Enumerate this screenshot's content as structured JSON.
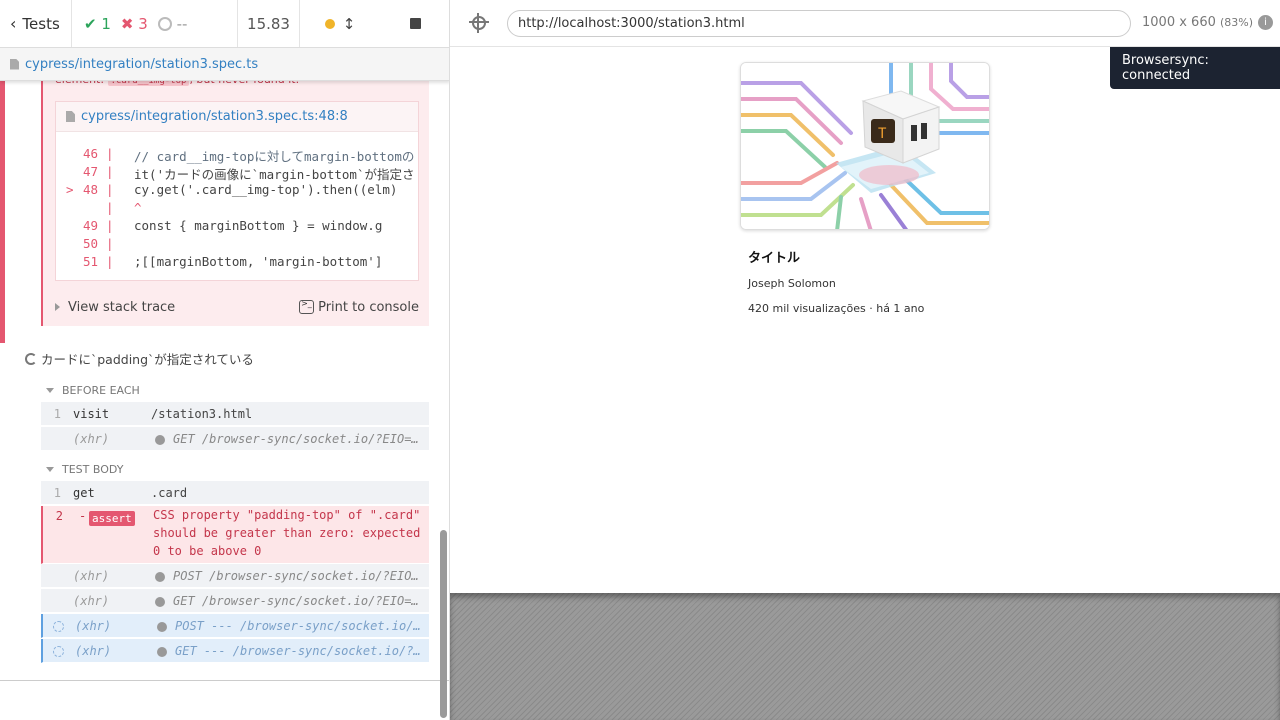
{
  "header": {
    "tests_label": "Tests",
    "passed": "1",
    "failed": "3",
    "pending": "--",
    "duration": "15.83"
  },
  "spec": {
    "file": "cypress/integration/station3.spec.ts"
  },
  "error": {
    "message_prefix": "element:",
    "message_code": ".card__img-top",
    "message_suffix": ", but never found it.",
    "frame_file": "cypress/integration/station3.spec.ts:48:8",
    "lines": [
      {
        "num": "46",
        "marker": "",
        "code": "// card__img-topに対してmargin-bottomの"
      },
      {
        "num": "47",
        "marker": "",
        "code": "it('カードの画像に`margin-bottom`が指定さ"
      },
      {
        "num": "48",
        "marker": ">",
        "code": "  cy.get('.card__img-top').then((elm)"
      },
      {
        "num": "",
        "marker": "",
        "code": "    ^"
      },
      {
        "num": "49",
        "marker": "",
        "code": "    const { marginBottom } = window.g"
      },
      {
        "num": "50",
        "marker": "",
        "code": ""
      },
      {
        "num": "51",
        "marker": "",
        "code": "    ;[[marginBottom, 'margin-bottom']"
      }
    ],
    "stack_trace_label": "View stack trace",
    "print_label": "Print to console"
  },
  "test": {
    "title": "カードに`padding`が指定されている"
  },
  "before_each": {
    "label": "BEFORE EACH",
    "commands": [
      {
        "n": "1",
        "name": "visit",
        "msg": "/station3.html"
      },
      {
        "xhr": "(xhr)",
        "msg": "GET /browser-sync/socket.io/?EIO=..."
      }
    ]
  },
  "test_body": {
    "label": "TEST BODY",
    "get": {
      "n": "1",
      "name": "get",
      "msg": ".card"
    },
    "assert": {
      "n": "2",
      "badge": "assert",
      "dash": "-",
      "msg": "CSS property \"padding-top\" of \".card\" should be greater than zero: expected 0 to be above 0"
    },
    "xhrs": [
      {
        "xhr": "(xhr)",
        "msg": "POST /browser-sync/socket.io/?EIO...",
        "pending": false
      },
      {
        "xhr": "(xhr)",
        "msg": "GET /browser-sync/socket.io/?EIO=...",
        "pending": false
      },
      {
        "xhr": "(xhr)",
        "msg": "POST --- /browser-sync/socket.io/...",
        "pending": true
      },
      {
        "xhr": "(xhr)",
        "msg": "GET --- /browser-sync/socket.io/?...",
        "pending": true
      }
    ]
  },
  "browser": {
    "url": "http://localhost:3000/station3.html",
    "viewport": "1000 x 660",
    "scale": "(83%)",
    "info": "i"
  },
  "app": {
    "title": "タイトル",
    "author": "Joseph Solomon",
    "meta": "420 mil visualizações · há 1 ano"
  },
  "toast": "Browsersync: connected",
  "colors": {
    "passed": "#2ca45b",
    "failed": "#e45770",
    "accent": "#3380c2"
  }
}
